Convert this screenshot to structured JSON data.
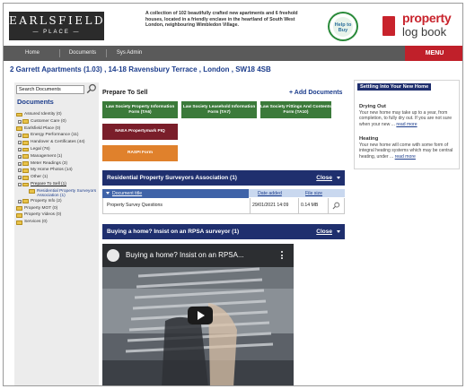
{
  "header": {
    "logo_line1": "EARLSFIELD",
    "logo_line2": "— PLACE —",
    "intro": "A collection of 102 beautifully crafted new apartments and 6 freehold houses, located in a friendly enclave in the heartland of South West London, neighbouring Wimbledon Village.",
    "help_badge": "Help to Buy",
    "property_logbook_line1": "property",
    "property_logbook_line2": "log book"
  },
  "nav": {
    "items": [
      "Home",
      "Documents",
      "Sys Admin"
    ],
    "menu_label": "MENU"
  },
  "address": "2 Garrett Apartments (1.03) , 14-18 Ravensbury Terrace , London , SW18 4SB",
  "sidebar": {
    "search_value": "Search Documents",
    "title": "Documents",
    "tree": [
      {
        "label": "Assured Identity (0)",
        "level": 0,
        "expander": ""
      },
      {
        "label": "Customer Care (0)",
        "level": 1,
        "expander": "+"
      },
      {
        "label": "Earlsfield Place (0)",
        "level": 0,
        "expander": ""
      },
      {
        "label": "Energy Performance (11)",
        "level": 1,
        "expander": "+"
      },
      {
        "label": "Handover & Certificates (44)",
        "level": 1,
        "expander": "+"
      },
      {
        "label": "Legal (76)",
        "level": 1,
        "expander": "+"
      },
      {
        "label": "Management (1)",
        "level": 1,
        "expander": "+"
      },
      {
        "label": "Meter Readings (3)",
        "level": 1,
        "expander": "+"
      },
      {
        "label": "My Home Photos (14)",
        "level": 1,
        "expander": "+"
      },
      {
        "label": "Other (1)",
        "level": 1,
        "expander": "+"
      },
      {
        "label": "Prepare To Sell (1)",
        "level": 1,
        "expander": "−",
        "selected": true
      },
      {
        "label": "Residential Property Surveyors Association (1)",
        "level": 2,
        "expander": "",
        "multiline": true
      },
      {
        "label": "Property Info (2)",
        "level": 1,
        "expander": "+"
      },
      {
        "label": "Property MOT (0)",
        "level": 0,
        "expander": ""
      },
      {
        "label": "Property Videos (0)",
        "level": 0,
        "expander": ""
      },
      {
        "label": "Services (0)",
        "level": 0,
        "expander": ""
      }
    ]
  },
  "main": {
    "title": "Prepare To Sell",
    "add_documents": "+ Add Documents",
    "buttons": {
      "ta6": "Law Society Property Information Form (TA6)",
      "ta7": "Law Society Leasehold Information Form (TA7)",
      "ta10": "Law Society Fittings And Contents Form (TA10)",
      "naea": "NAEA Propertymark PIQ",
      "raspi": "RASPI Form"
    },
    "rpsa_panel": {
      "title": "Residential Property Surveyors Association (1)",
      "close": "Close"
    },
    "table": {
      "headers": {
        "title": "Document title",
        "date": "Date added",
        "size": "File size"
      },
      "rows": [
        {
          "title": "Property Survey Questions",
          "date": "29/01/2021 14:09",
          "size": "0.14 MB"
        }
      ]
    },
    "video_panel": {
      "title": "Buying a home? Insist on an RPSA surveyor (1)",
      "close": "Close",
      "video_title": "Buying a home? Insist on an RPSA..."
    }
  },
  "right_panel": {
    "title": "Settling Into Your New Home",
    "sections": [
      {
        "heading": "Drying Out",
        "body": "Your new home may take up to a year, from completion, to fully dry out. If you are not sure when your new ...",
        "more": "read more"
      },
      {
        "heading": "Heating",
        "body": "Your new home will come with some form of integral heating systems which may be central heating, under ...",
        "more": "read more"
      }
    ]
  },
  "colors": {
    "navy": "#1f2f6e",
    "brand_red": "#c0202a",
    "button_green": "#3b7a3a",
    "button_maroon": "#7a1e2a",
    "button_orange": "#e0812c",
    "link_blue": "#1c3d8c"
  }
}
